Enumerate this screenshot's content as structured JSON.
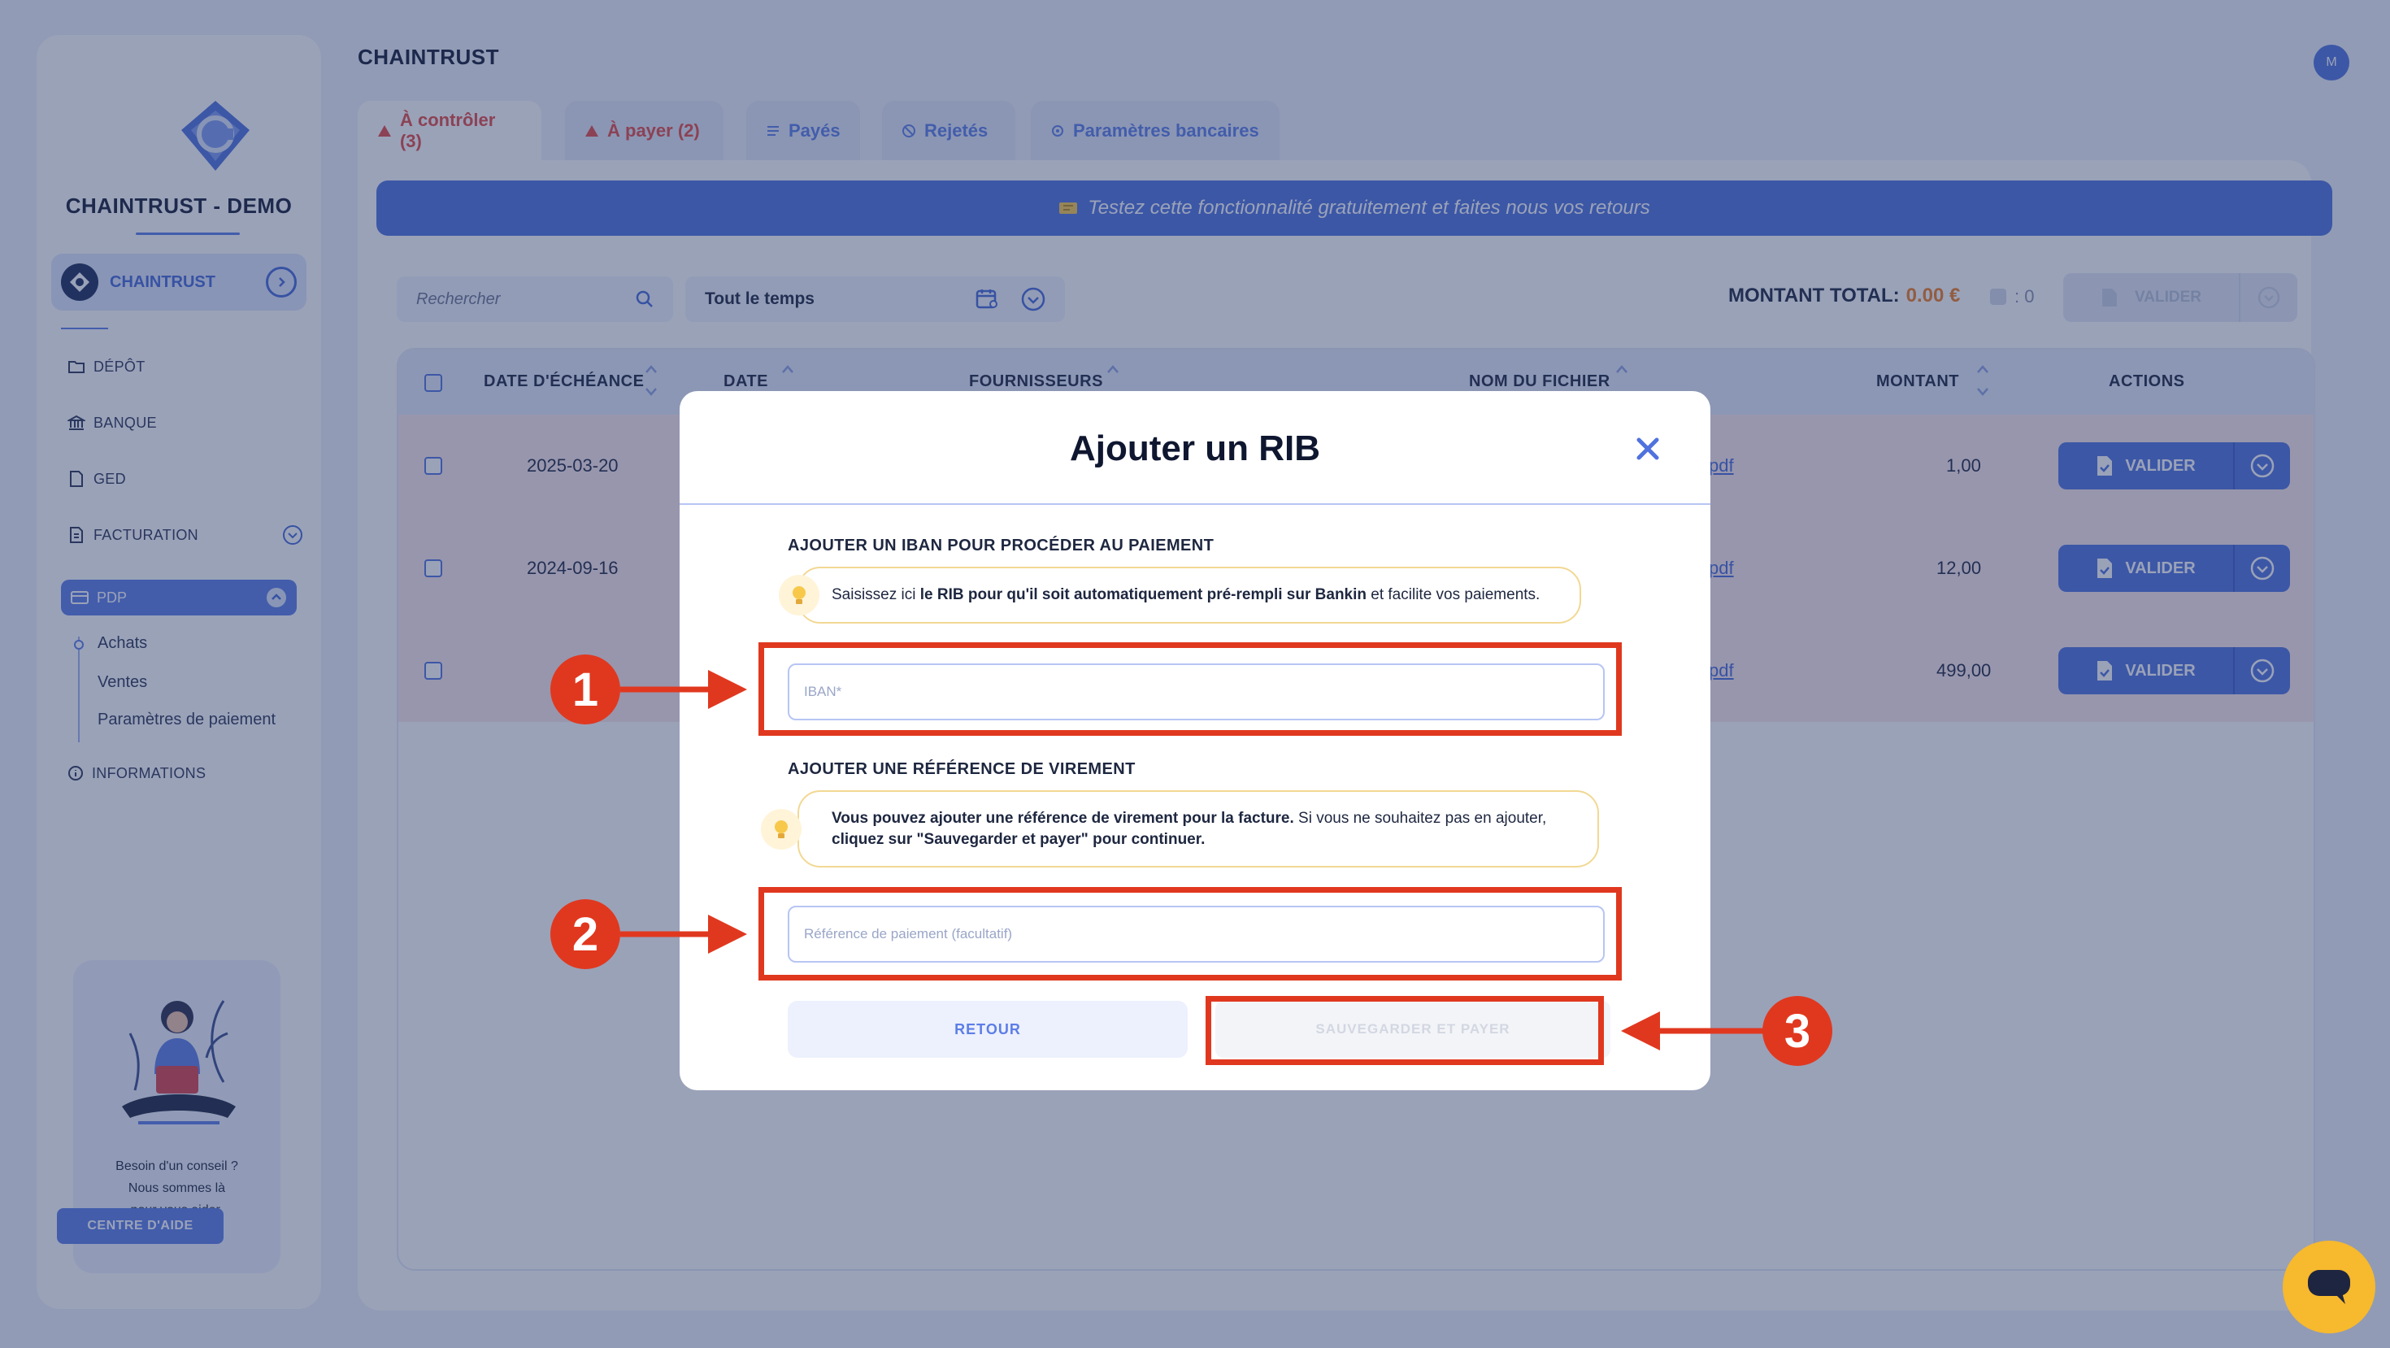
{
  "sidebar": {
    "brand": "CHAINTRUST - DEMO",
    "company": "CHAINTRUST",
    "items": {
      "depot": "DÉPÔT",
      "banque": "BANQUE",
      "ged": "GED",
      "facturation": "FACTURATION",
      "pdp": "PDP",
      "informations": "INFORMATIONS"
    },
    "sub_items": [
      "Achats",
      "Ventes",
      "Paramètres de paiement"
    ],
    "help": {
      "line1": "Besoin d'un conseil ?",
      "line2": "Nous sommes là",
      "line3": "pour vous aider.",
      "button": "CENTRE D'AIDE"
    }
  },
  "header": {
    "title": "CHAINTRUST",
    "avatar": "M"
  },
  "tabs": [
    {
      "label": "À contrôler (3)"
    },
    {
      "label": "À payer (2)"
    },
    {
      "label": "Payés"
    },
    {
      "label": "Rejetés"
    },
    {
      "label": "Paramètres bancaires"
    }
  ],
  "banner": "Testez cette fonctionnalité gratuitement et faites nous vos retours",
  "toolbar": {
    "search_placeholder": "Rechercher",
    "period": "Tout le temps",
    "total_label": "MONTANT TOTAL:",
    "total_amount": "0.00 €",
    "count": ": 0",
    "validate": "VALIDER"
  },
  "table": {
    "columns": [
      "DATE D'ÉCHÉANCE",
      "DATE",
      "FOURNISSEURS",
      "NOM DU FICHIER",
      "MONTANT",
      "ACTIONS"
    ],
    "rows": [
      {
        "due": "2025-03-20",
        "file": "pdf",
        "amount": "1,00",
        "action": "VALIDER"
      },
      {
        "due": "2024-09-16",
        "file": "pdf",
        "amount": "12,00",
        "action": "VALIDER"
      },
      {
        "due": "",
        "file": "pdf",
        "amount": "499,00",
        "action": "VALIDER"
      }
    ]
  },
  "modal": {
    "title": "Ajouter un RIB",
    "iban_section": "AJOUTER UN IBAN POUR PROCÉDER AU PAIEMENT",
    "iban_info_pre": "Saisissez ici ",
    "iban_info_bold": "le RIB pour qu'il soit automatiquement pré-rempli sur Bankin",
    "iban_info_post": " et facilite vos paiements.",
    "iban_placeholder": "IBAN*",
    "ref_section": "AJOUTER UNE RÉFÉRENCE DE VIREMENT",
    "ref_info_bold1": "Vous pouvez ajouter une référence de virement pour la facture.",
    "ref_info_mid": " Si vous ne souhaitez pas en ajouter,",
    "ref_info_bold2": "cliquez sur \"Sauvegarder et payer\" pour continuer.",
    "ref_placeholder": "Référence de paiement (facultatif)",
    "back": "RETOUR",
    "save": "SAUVEGARDER ET PAYER"
  },
  "annotations": [
    "1",
    "2",
    "3"
  ],
  "colors": {
    "accent": "#4f72de",
    "annotation": "#e0381f",
    "warning": "#e24a44",
    "total": "#ef7d20"
  }
}
